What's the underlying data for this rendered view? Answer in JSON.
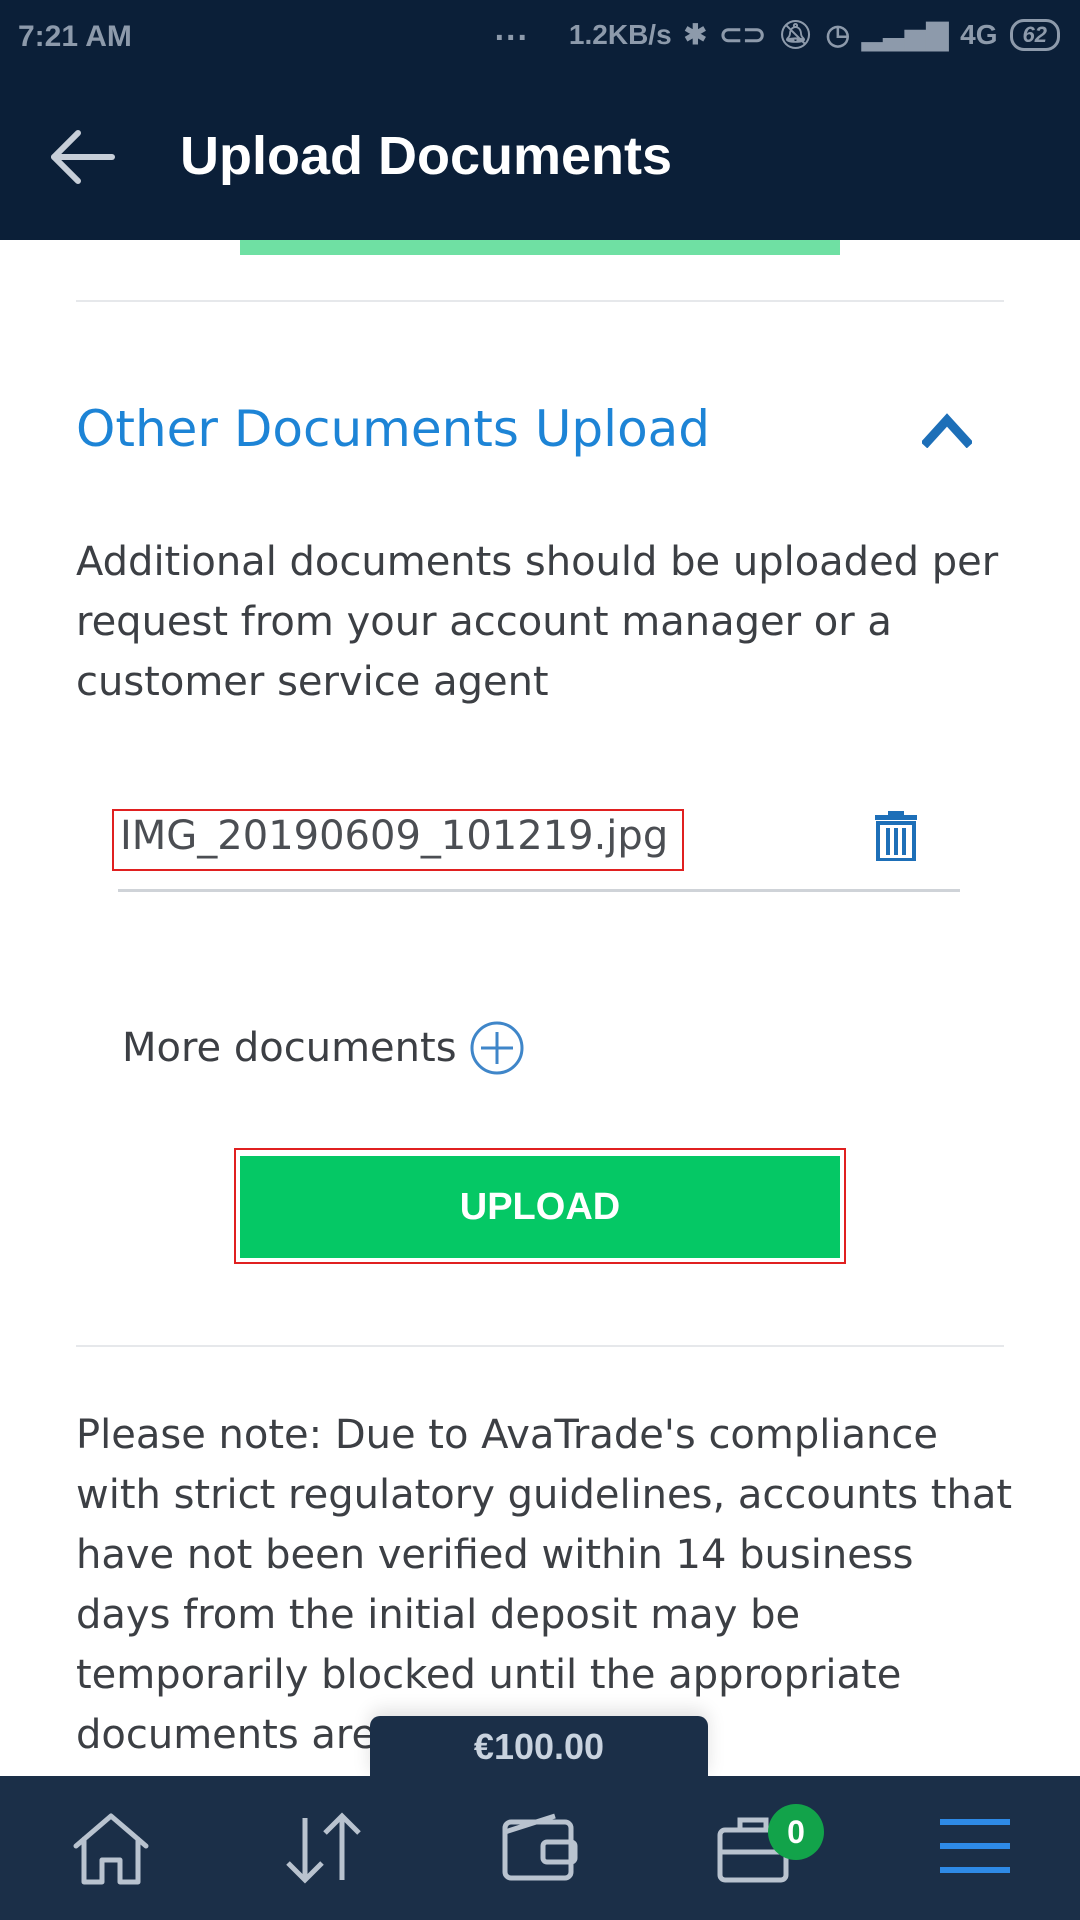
{
  "status_bar": {
    "time": "7:21 AM",
    "more": "...",
    "speed": "1.2KB/s",
    "network": "4G",
    "battery": "62",
    "icons": [
      "bluetooth-icon",
      "toggle-icon",
      "mute-icon",
      "alarm-icon",
      "signal-icon"
    ]
  },
  "header": {
    "title": "Upload Documents",
    "back_icon": "back-arrow-icon"
  },
  "section": {
    "title": "Other Documents Upload",
    "description": "Additional documents should be uploaded per request from your account manager or a customer service agent"
  },
  "file": {
    "name": "IMG_20190609_101219.jpg"
  },
  "more_documents_label": "More documents",
  "upload_label": "UPLOAD",
  "note": "Please note: Due to AvaTrade's compliance with strict regulatory guidelines, accounts that have not been verified within 14 business days from the initial deposit may be temporarily blocked until the appropriate documents are supplied.",
  "balance": "€100.00",
  "bottom_nav": {
    "items": [
      "home-icon",
      "transfer-icon",
      "wallet-icon",
      "briefcase-icon",
      "menu-icon"
    ],
    "briefcase_badge": "0"
  },
  "colors": {
    "header_bg": "#0b1f38",
    "accent_blue": "#1d84d6",
    "upload_green": "#05c865",
    "nav_bg": "#1b2f48",
    "badge_green": "#12a34a"
  }
}
